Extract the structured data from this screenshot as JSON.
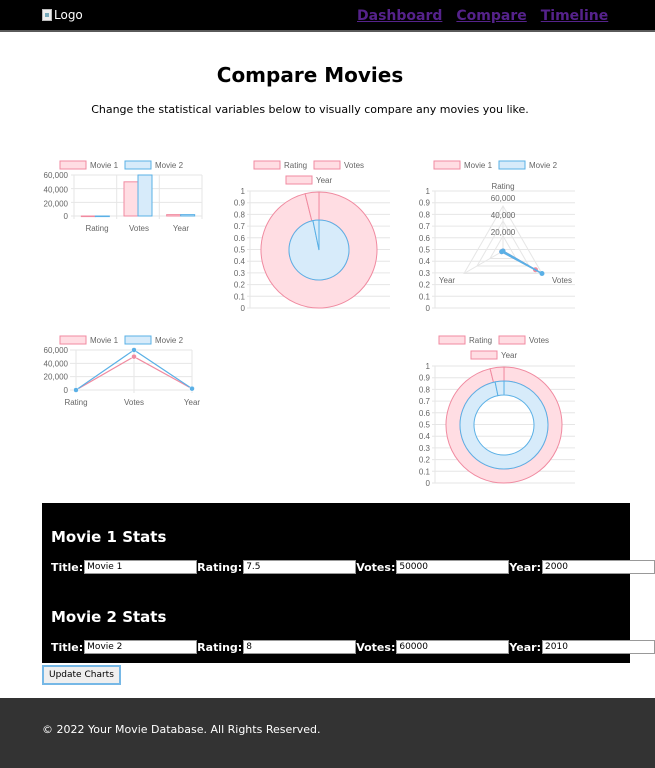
{
  "header": {
    "logo_alt": "Logo",
    "nav": [
      {
        "label": "Dashboard"
      },
      {
        "label": "Compare"
      },
      {
        "label": "Timeline"
      }
    ]
  },
  "page": {
    "title": "Compare Movies",
    "subtitle": "Change the statistical variables below to visually compare any movies you like."
  },
  "chart_data": [
    {
      "type": "bar",
      "categories": [
        "Rating",
        "Votes",
        "Year"
      ],
      "series": [
        {
          "name": "Movie 1",
          "values": [
            7.5,
            50000,
            2000
          ]
        },
        {
          "name": "Movie 2",
          "values": [
            8,
            60000,
            2010
          ]
        }
      ],
      "ytick_labels": [
        "0",
        "20,000",
        "40,000",
        "60,000"
      ],
      "ylim": [
        0,
        60000
      ]
    },
    {
      "type": "pie",
      "legend": [
        "Rating",
        "Votes",
        "Year"
      ],
      "rings": [
        {
          "name": "Movie 1",
          "values": [
            7.5,
            50000,
            2000
          ]
        },
        {
          "name": "Movie 2",
          "values": [
            8,
            60000,
            2010
          ]
        }
      ],
      "ytick_labels": [
        "0",
        "0.1",
        "0.2",
        "0.3",
        "0.4",
        "0.5",
        "0.6",
        "0.7",
        "0.8",
        "0.9",
        "1"
      ]
    },
    {
      "type": "radar",
      "labels": [
        "Rating",
        "Votes",
        "Year"
      ],
      "series": [
        {
          "name": "Movie 1",
          "values": [
            7.5,
            50000,
            2000
          ]
        },
        {
          "name": "Movie 2",
          "values": [
            8,
            60000,
            2010
          ]
        }
      ],
      "rtick_labels": [
        "20,000",
        "40,000",
        "60,000"
      ],
      "ytick_labels": [
        "0",
        "0.1",
        "0.2",
        "0.3",
        "0.4",
        "0.5",
        "0.6",
        "0.7",
        "0.8",
        "0.9",
        "1"
      ]
    },
    {
      "type": "line",
      "categories": [
        "Rating",
        "Votes",
        "Year"
      ],
      "series": [
        {
          "name": "Movie 1",
          "values": [
            7.5,
            50000,
            2000
          ]
        },
        {
          "name": "Movie 2",
          "values": [
            8,
            60000,
            2010
          ]
        }
      ],
      "ytick_labels": [
        "0",
        "20,000",
        "40,000",
        "60,000"
      ],
      "ylim": [
        0,
        60000
      ]
    },
    {
      "type": "doughnut",
      "legend": [
        "Rating",
        "Votes",
        "Year"
      ],
      "rings": [
        {
          "name": "Movie 1",
          "values": [
            7.5,
            50000,
            2000
          ]
        },
        {
          "name": "Movie 2",
          "values": [
            8,
            60000,
            2010
          ]
        }
      ],
      "ytick_labels": [
        "0",
        "0.1",
        "0.2",
        "0.3",
        "0.4",
        "0.5",
        "0.6",
        "0.7",
        "0.8",
        "0.9",
        "1"
      ]
    }
  ],
  "colors": {
    "movie1_fill": "#ffdde3",
    "movie1_stroke": "#f08aa0",
    "movie2_fill": "#d7ebfa",
    "movie2_stroke": "#5ab0e6",
    "grid": "#e6e6e6"
  },
  "stats": {
    "movie1": {
      "heading": "Movie 1 Stats",
      "title_label": "Title:",
      "title_value": "Movie 1",
      "rating_label": "Rating:",
      "rating_value": "7.5",
      "votes_label": "Votes:",
      "votes_value": "50000",
      "year_label": "Year:",
      "year_value": "2000"
    },
    "movie2": {
      "heading": "Movie 2 Stats",
      "title_label": "Title:",
      "title_value": "Movie 2",
      "rating_label": "Rating:",
      "rating_value": "8",
      "votes_label": "Votes:",
      "votes_value": "60000",
      "year_label": "Year:",
      "year_value": "2010"
    }
  },
  "update_button": "Update Charts",
  "footer": "© 2022 Your Movie Database. All Rights Reserved."
}
